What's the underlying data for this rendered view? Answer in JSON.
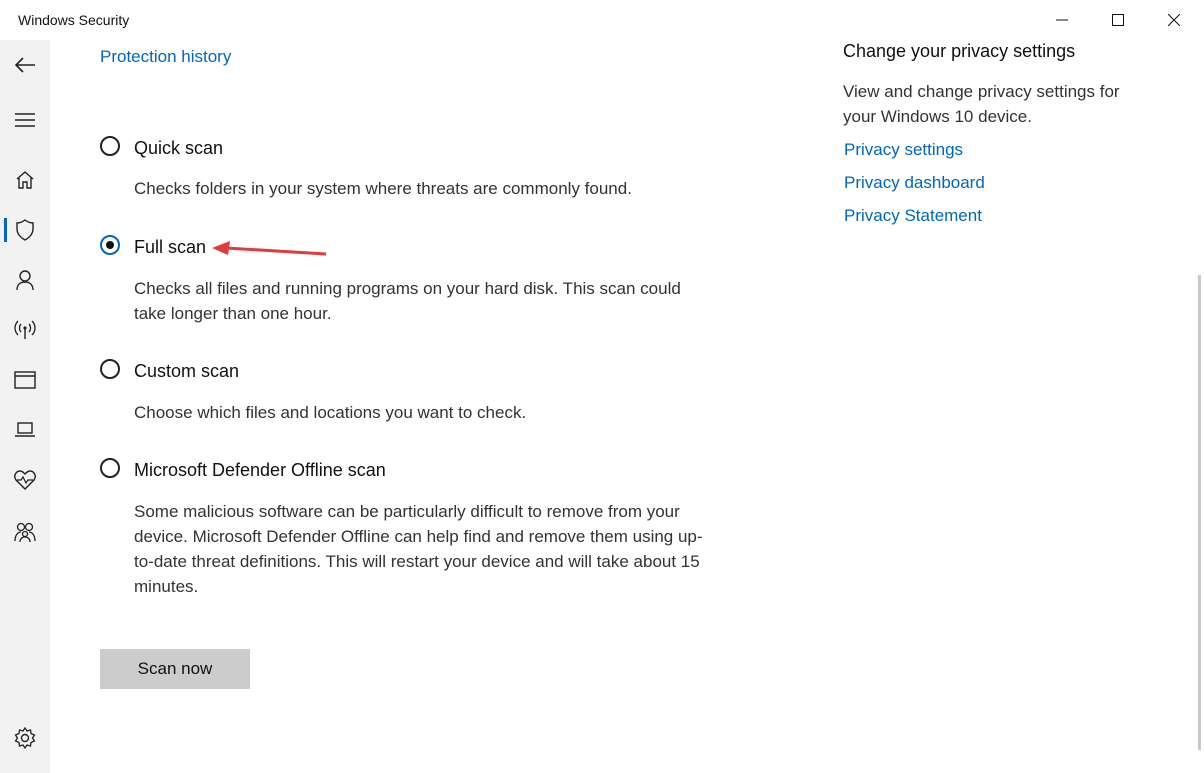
{
  "window": {
    "title": "Windows Security"
  },
  "sidebar": {
    "items": [
      {
        "icon": "back-arrow-icon"
      },
      {
        "icon": "hamburger-menu-icon"
      },
      {
        "icon": "home-icon"
      },
      {
        "icon": "shield-icon"
      },
      {
        "icon": "person-icon"
      },
      {
        "icon": "wireless-icon"
      },
      {
        "icon": "browser-window-icon"
      },
      {
        "icon": "laptop-icon"
      },
      {
        "icon": "heart-pulse-icon"
      },
      {
        "icon": "family-icon"
      },
      {
        "icon": "gear-icon"
      }
    ],
    "active": "shield-icon"
  },
  "main": {
    "history_link": "Protection history",
    "options": [
      {
        "label": "Quick scan",
        "desc": "Checks folders in your system where threats are commonly found.",
        "checked": false
      },
      {
        "label": "Full scan",
        "desc": "Checks all files and running programs on your hard disk. This scan could take longer than one hour.",
        "checked": true
      },
      {
        "label": "Custom scan",
        "desc": "Choose which files and locations you want to check.",
        "checked": false
      },
      {
        "label": "Microsoft Defender Offline scan",
        "desc": "Some malicious software can be particularly difficult to remove from your device. Microsoft Defender Offline can help find and remove them using up-to-date threat definitions. This will restart your device and will take about 15 minutes.",
        "checked": false
      }
    ],
    "scan_button": "Scan now"
  },
  "aside": {
    "title": "Change your privacy settings",
    "desc": "View and change privacy settings for your Windows 10 device.",
    "links": [
      "Privacy settings",
      "Privacy dashboard",
      "Privacy Statement"
    ]
  },
  "colors": {
    "accent": "#0067c0",
    "annotation_arrow": "#e03c3c",
    "sidebar_bg": "#f2f2f2",
    "button_bg": "#cccccc"
  }
}
